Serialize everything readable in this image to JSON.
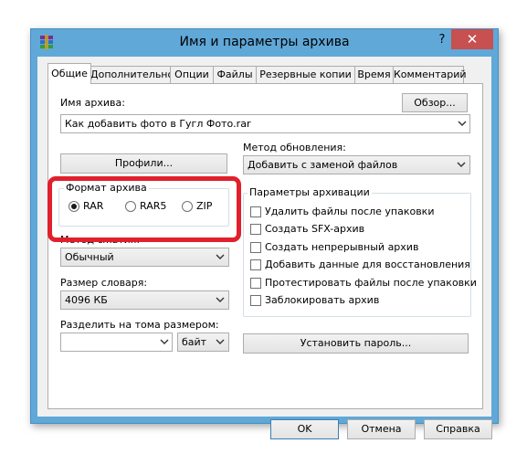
{
  "window": {
    "title": "Имя и параметры архива",
    "help_label": "?",
    "close_label": "✕"
  },
  "tabs": [
    {
      "label": "Общие",
      "active": true
    },
    {
      "label": "Дополнительно"
    },
    {
      "label": "Опции"
    },
    {
      "label": "Файлы"
    },
    {
      "label": "Резервные копии"
    },
    {
      "label": "Время"
    },
    {
      "label": "Комментарий"
    }
  ],
  "general": {
    "archive_name_label": "Имя архива:",
    "browse_button": "Обзор...",
    "archive_name_value": "Как добавить фото в Гугл Фото.rar",
    "profiles_button": "Профили...",
    "update_method_label": "Метод обновления:",
    "update_method_value": "Добавить с заменой файлов",
    "archive_format": {
      "title": "Формат архива",
      "options": [
        "RAR",
        "RAR5",
        "ZIP"
      ],
      "selected": "RAR",
      "highlight_color": "#e0202c"
    },
    "compression_label": "Метод сжатия:",
    "compression_value": "Обычный",
    "dictionary_label": "Размер словаря:",
    "dictionary_value": "4096 КБ",
    "split_label": "Разделить на тома размером:",
    "split_value": "",
    "split_unit": "байт",
    "archive_options": {
      "title": "Параметры архивации",
      "items": [
        "Удалить файлы после упаковки",
        "Создать SFX-архив",
        "Создать непрерывный архив",
        "Добавить данные для восстановления",
        "Протестировать файлы после упаковки",
        "Заблокировать архив"
      ]
    },
    "set_password_button": "Установить пароль..."
  },
  "footer": {
    "ok_button": "OK",
    "cancel_button": "Отмена",
    "help_button": "Справка"
  },
  "colors": {
    "titlebar": "#5fa8d8",
    "close_button": "#c75050"
  }
}
